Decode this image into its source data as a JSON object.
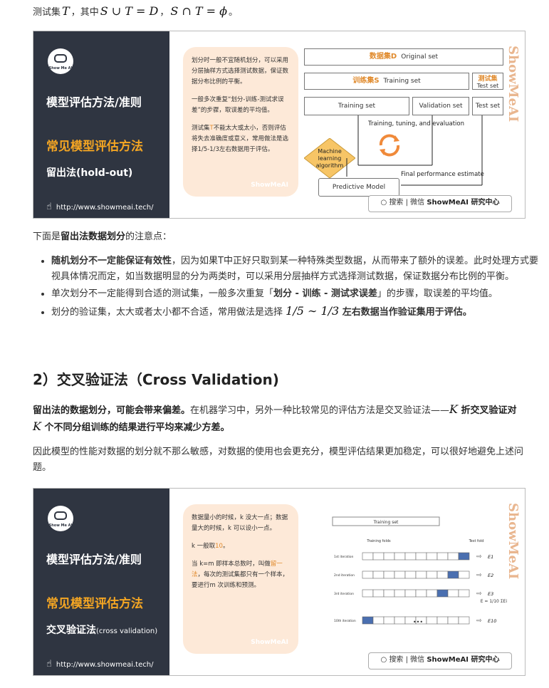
{
  "top_line": {
    "prefix": "测试集",
    "T": "T",
    "mid": "，其中",
    "formula1": "S ∪ T = D",
    "sep": "，",
    "formula2": "S ∩ T = ϕ",
    "end": "。"
  },
  "figure1": {
    "logo_brand": "Show Me AI",
    "title": "模型评估方法/准则",
    "subtitle": "常见模型评估方法",
    "method_cn": "留出法",
    "method_en": "(hold-out)",
    "url": "http://www.showmeai.tech/",
    "note": {
      "p1": "划分时一般不宜随机划分，可以采用分层抽样方式选择测试数据，保证数据分布比例的平衡。",
      "p2": "一般多次重复“划分-训练-测试求误差”的步骤，取误差的平均值。",
      "p3_a": "测试集",
      "p3_t": "T",
      "p3_b": "不能太大或太小，否则评估将失去准确度或意义，常用做法是选择1/5-1/3左右数据用于评估。",
      "watermark": "ShowMeAI"
    },
    "diagram": {
      "dataset_cn": "数据集D",
      "dataset_en": "Original set",
      "train_cn": "训练集S",
      "train_en": "Training set",
      "test_cn": "测试集",
      "test_en": "Test set",
      "row3_training": "Training set",
      "row3_validation": "Validation set",
      "row3_test": "Test set",
      "tuning": "Training, tuning, and evaluation",
      "algorithm": "Machine learning algorithm",
      "final": "Final performance estimate",
      "model": "Predictive Model"
    },
    "search_text": "搜索 | 微信",
    "search_brand": "ShowMeAI 研究中心",
    "vertical_wm": "ShowMeAI"
  },
  "intro": {
    "before": "下面是",
    "bold": "留出法数据划分",
    "after": "的注意点："
  },
  "bullets": {
    "b1_bold": "随机划分不一定能保证有效性",
    "b1_rest": "，因为如果T中正好只取到某一种特殊类型数据，从而带来了额外的误差。此时处理方式要视具体情况而定，如当数据明显的分为两类时，可以采用分层抽样方式选择测试数据，保证数据分布比例的平衡。",
    "b2_a": "单次划分不一定能得到合适的测试集，一般多次重复「",
    "b2_bold": "划分 - 训练 - 测试求误差",
    "b2_b": "」的步骤，取误差的平均值。",
    "b3_a": "划分的验证集，太大或者太小都不合适，常用做法是选择 ",
    "b3_math": "1/5 ∼ 1/3",
    "b3_bold": " 左右数据当作验证集用于评估。"
  },
  "section2": {
    "title": "2）交叉验证法（Cross Validation)"
  },
  "cv_para1": {
    "bold1": "留出法的数据划分，可能会带来偏差。",
    "rest1": "在机器学习中，另外一种比较常见的评估方法是交叉验证法——",
    "K1": "K",
    "bold2": " 折交叉验证对 ",
    "K2": "K",
    "bold3": " 个不同分组训练的结果进行平均来减少方差。"
  },
  "cv_para2": {
    "text": "因此模型的性能对数据的划分就不那么敏感，对数据的使用也会更充分，模型评估结果更加稳定，可以很好地避免上述问题。"
  },
  "figure2": {
    "logo_brand": "Show Me AI",
    "title": "模型评估方法/准则",
    "subtitle": "常见模型评估方法",
    "method_cn": "交叉验证法",
    "method_en": "(cross validation)",
    "url": "http://www.showmeai.tech/",
    "note": {
      "p1": "数据量小的时候，k 没大一点；数据量大的时候，k 可以设小一点。",
      "p2_a": "k 一般取",
      "p2_hl": "10",
      "p2_b": "。",
      "p3_a": "当 k=m 即样本总数时，叫做",
      "p3_hl": "留一法",
      "p3_b": "，每次的测试集都只有一个样本，要进行m 次训练和预测。",
      "watermark": "ShowMeAI"
    },
    "grid": {
      "training_set": "Training set",
      "training_folds": "Training folds",
      "test_fold": "Test fold",
      "iter1": "1st iteration",
      "iter2": "2nd iteration",
      "iter3": "3rd iteration",
      "iter10": "10th iteration",
      "e1": "E1",
      "e2": "E2",
      "e3": "E3",
      "e10": "E10",
      "dots": "•••",
      "formula": "E = 1/10 ΣEi"
    },
    "search_text": "搜索 | 微信",
    "search_brand": "ShowMeAI 研究中心",
    "vertical_wm": "ShowMeAI"
  },
  "colors": {
    "panel": "#2f3541",
    "accent": "#f5a623",
    "note_bg": "#fde9d8",
    "fold_test": "#4a6fb0"
  }
}
